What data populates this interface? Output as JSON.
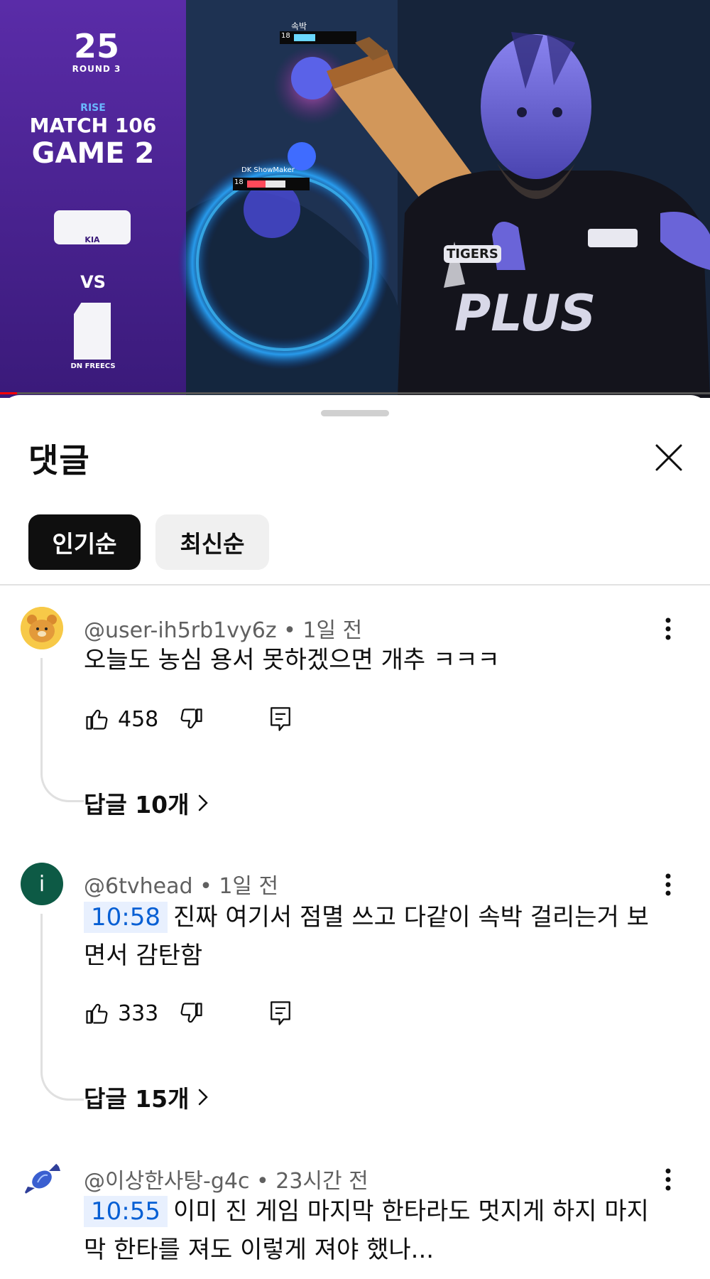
{
  "video": {
    "overlay": {
      "season": "25",
      "round": "ROUND 3",
      "sponsor": "RISE",
      "match": "MATCH 106",
      "game": "GAME 2",
      "team1_sponsor": "KIA",
      "vs": "VS",
      "team2": "DN FREECS",
      "player_name_top": "속박",
      "player_name": "DK ShowMaker",
      "player_level_top": "18",
      "player_level": "18",
      "jersey_text": "PLUS",
      "jersey_badge": "TIGERS"
    }
  },
  "sheet": {
    "title": "댓글",
    "sort_tabs": [
      {
        "label": "인기순",
        "active": true
      },
      {
        "label": "최신순",
        "active": false
      }
    ]
  },
  "comments": [
    {
      "author": "@user-ih5rb1vy6z",
      "time": "1일 전",
      "timestamp": "",
      "text": "오늘도 농심 용서 못하겠으면 개추 ㅋㅋㅋ",
      "likes": "458",
      "replies": "답글 10개",
      "avatar_color": "#f7c948"
    },
    {
      "author": "@6tvhead",
      "time": "1일 전",
      "timestamp": "10:58",
      "text": "진짜 여기서 점멸 쓰고 다같이 속박 걸리는거 보면서 감탄함",
      "likes": "333",
      "replies": "답글 15개",
      "avatar_letter": "i",
      "avatar_color": "#0d5a45"
    },
    {
      "author": "@이상한사탕-g4c",
      "time": "23시간 전",
      "timestamp": "10:55",
      "text": "이미 진 게임 마지막 한타라도 멋지게 하지 마지막 한타를 져도 이렇게 져야 했나...",
      "avatar_color": "#3a5fd0"
    }
  ],
  "separator": "•"
}
